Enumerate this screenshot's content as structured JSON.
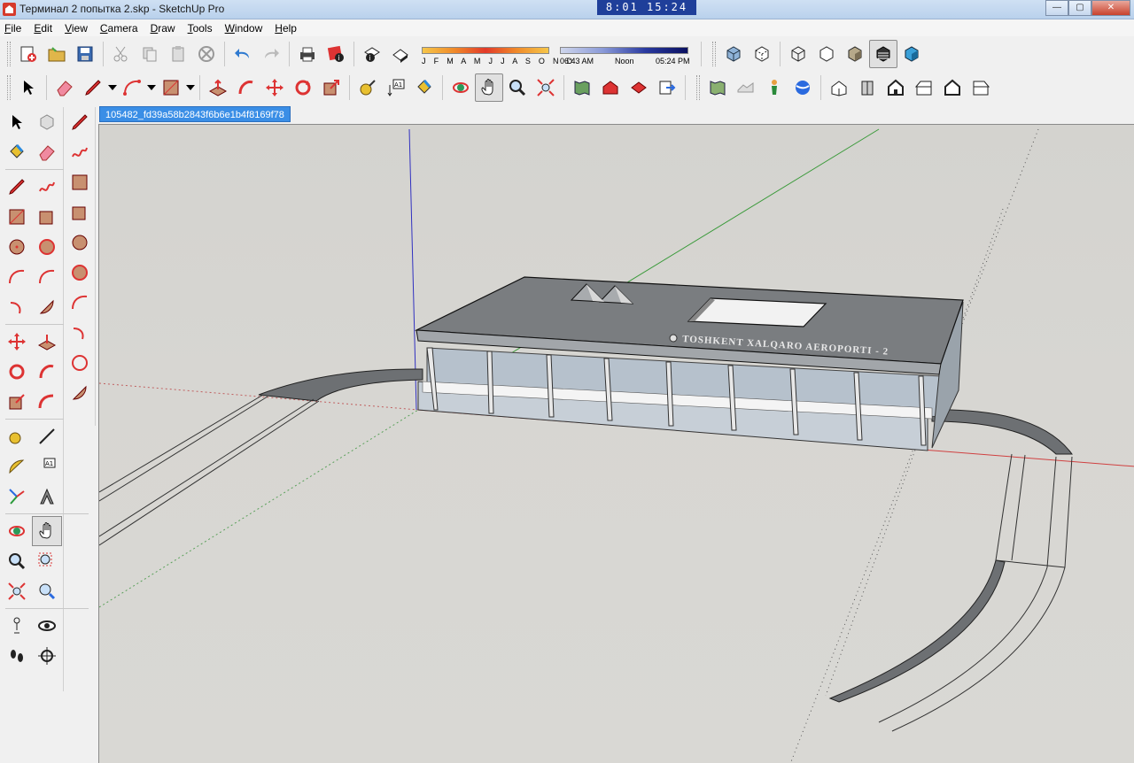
{
  "window": {
    "title": "Терминал 2 попытка 2.skp - SketchUp Pro",
    "clock": "8:01  15:24",
    "controls": {
      "minimize": "—",
      "maximize": "▢",
      "close": "✕"
    }
  },
  "menu": [
    "File",
    "Edit",
    "View",
    "Camera",
    "Draw",
    "Tools",
    "Window",
    "Help"
  ],
  "shadows": {
    "months": "J F M A M J J A S O N D",
    "sunrise": "06:43 AM",
    "noon": "Noon",
    "sunset": "05:24 PM"
  },
  "document_tab": "105482_fd39a58b2843f6b6e1b4f8169f78",
  "model_sign": "TOSHKENT XALQARO AEROPORTI - 2",
  "colors": {
    "viewport_bg": "#d8d7d3",
    "roof": "#7a7d80",
    "axis_red": "#d04040",
    "axis_green": "#3a9a3a",
    "axis_blue": "#3030c0",
    "tab_active": "#3a8ee6"
  }
}
